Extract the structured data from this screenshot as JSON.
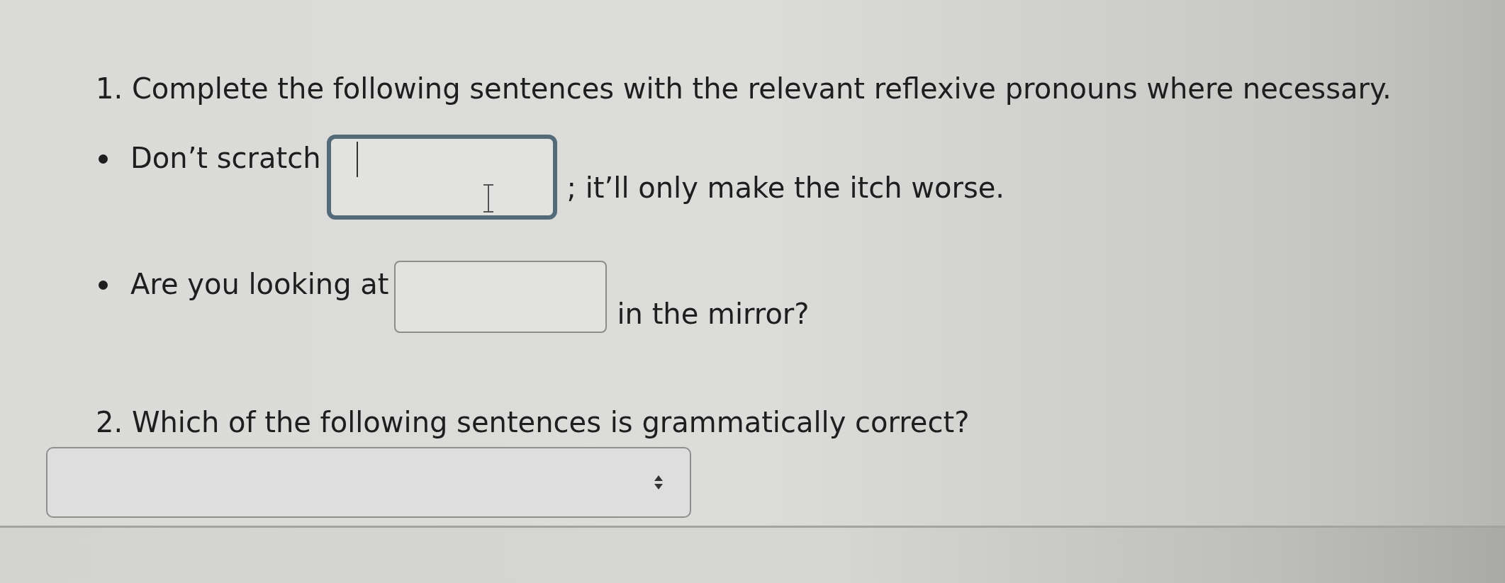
{
  "questions": [
    {
      "kind": "fill_in",
      "prompt": "1. Complete the following sentences with the relevant reflexive pronouns where necessary.",
      "items": [
        {
          "before": "Don’t scratch",
          "after": "; it’ll only make the itch worse.",
          "focused": true
        },
        {
          "before": "Are you looking at",
          "after": "in the mirror?",
          "focused": false
        }
      ]
    },
    {
      "kind": "dropdown",
      "prompt": "2. Which of the following sentences is grammatically correct?"
    }
  ]
}
